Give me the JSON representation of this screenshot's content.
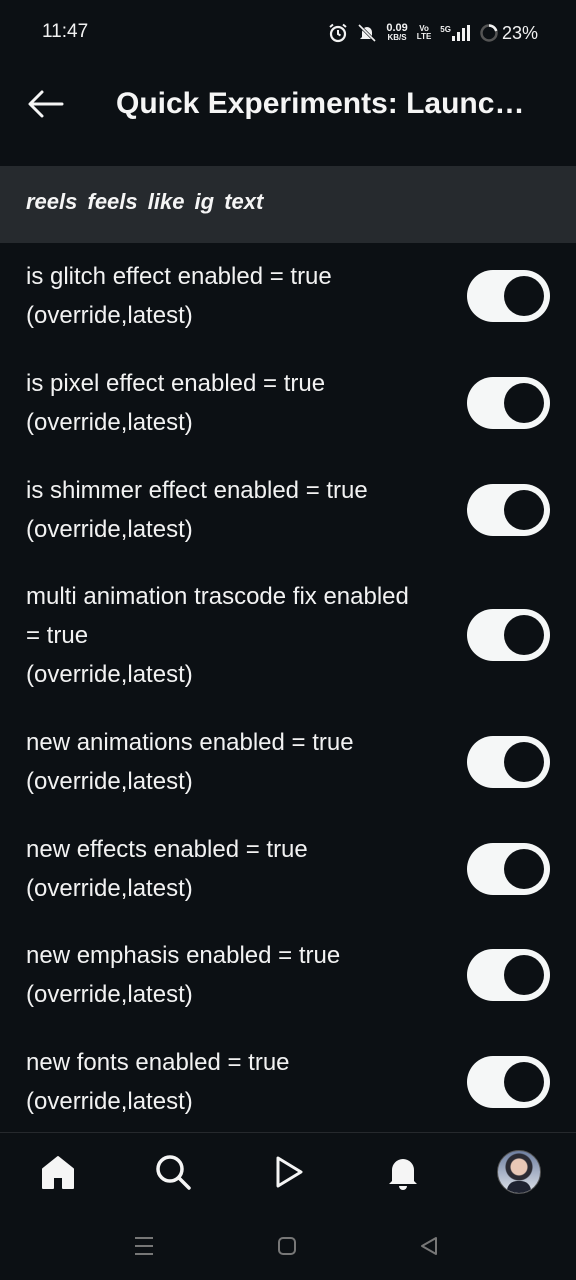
{
  "status_bar": {
    "time": "11:47",
    "net_speed_value": "0.09",
    "net_speed_unit": "KB/S",
    "volte_top": "Vo",
    "volte_bottom": "LTE",
    "network": "5G",
    "battery": "23%",
    "icons": [
      "alarm-icon",
      "mute-icon",
      "signal-icon",
      "battery-icon"
    ]
  },
  "app_bar": {
    "back_icon": "arrow-left-icon",
    "title": "Quick Experiments: Launc…"
  },
  "section": {
    "title": "reels feels like ig text"
  },
  "experiments": [
    {
      "label": "is glitch effect enabled = true",
      "source": "(override,latest)",
      "enabled": true
    },
    {
      "label": "is pixel effect enabled = true",
      "source": "(override,latest)",
      "enabled": true
    },
    {
      "label": "is shimmer effect enabled = true",
      "source": "(override,latest)",
      "enabled": true
    },
    {
      "label": "multi animation trascode fix enabled",
      "label_cont": "= true",
      "source": "(override,latest)",
      "enabled": true
    },
    {
      "label": "new animations enabled = true",
      "source": "(override,latest)",
      "enabled": true
    },
    {
      "label": "new effects enabled = true",
      "source": "(override,latest)",
      "enabled": true
    },
    {
      "label": "new emphasis enabled = true",
      "source": "(override,latest)",
      "enabled": true
    },
    {
      "label": "new fonts enabled = true",
      "source": "(override,latest)",
      "enabled": true
    }
  ],
  "bottom_nav": {
    "items": [
      "home-icon",
      "search-icon",
      "reels-icon",
      "notifications-icon",
      "profile-avatar"
    ]
  },
  "system_nav": {
    "items": [
      "recents-icon",
      "home-square-icon",
      "back-triangle-icon"
    ]
  },
  "colors": {
    "background": "#0c1014",
    "section_bg": "#262a2e",
    "toggle_track": "#f5f7f7",
    "text": "#f2f2f2"
  }
}
